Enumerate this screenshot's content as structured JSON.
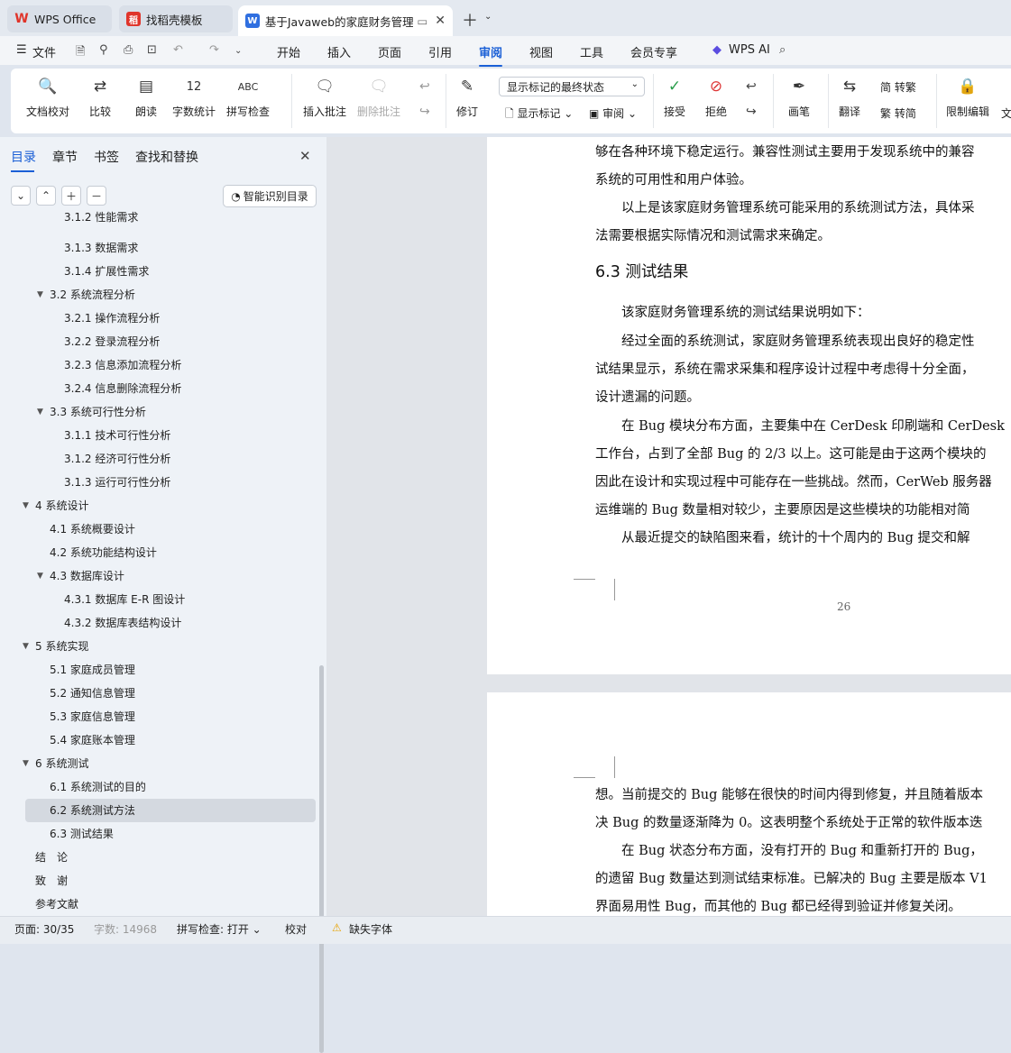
{
  "tabs": [
    {
      "label": "WPS Office",
      "icon": "wps-logo-icon"
    },
    {
      "label": "找稻壳模板",
      "icon": "docer-icon"
    },
    {
      "label": "基于Javaweb的家庭财务管理系",
      "icon": "word-doc-icon"
    }
  ],
  "menu": {
    "file": "文件",
    "items": [
      "开始",
      "插入",
      "页面",
      "引用",
      "审阅",
      "视图",
      "工具",
      "会员专享"
    ],
    "active": "审阅",
    "ai": "WPS AI"
  },
  "ribbon": {
    "doc_check": "文档校对",
    "compare": "比较",
    "read": "朗读",
    "word_count": "字数统计",
    "spell_check": "拼写检查",
    "insert_comment": "插入批注",
    "delete_comment": "删除批注",
    "revise": "修订",
    "display_select": "显示标记的最终状态",
    "show_marks": "显示标记",
    "review": "审阅",
    "accept": "接受",
    "reject": "拒绝",
    "pen": "画笔",
    "translate": "翻译",
    "to_trad": "转繁",
    "to_simp": "转简",
    "restrict": "限制编辑",
    "overflow": "文"
  },
  "sidebar": {
    "tabs": [
      "目录",
      "章节",
      "书签",
      "查找和替换"
    ],
    "smart_btn": "智能识别目录",
    "toc": [
      {
        "label": "3.1.2 性能需求",
        "lvl": 3
      },
      {
        "label": "3.1.3 数据需求",
        "lvl": 3
      },
      {
        "label": "3.1.4 扩展性需求",
        "lvl": 3
      },
      {
        "label": "3.2 系统流程分析",
        "lvl": 2,
        "exp": true
      },
      {
        "label": "3.2.1  操作流程分析",
        "lvl": 3
      },
      {
        "label": "3.2.2  登录流程分析",
        "lvl": 3
      },
      {
        "label": "3.2.3  信息添加流程分析",
        "lvl": 3
      },
      {
        "label": "3.2.4  信息删除流程分析",
        "lvl": 3
      },
      {
        "label": "3.3  系统可行性分析",
        "lvl": 2,
        "exp": true
      },
      {
        "label": "3.1.1  技术可行性分析",
        "lvl": 3
      },
      {
        "label": "3.1.2  经济可行性分析",
        "lvl": 3
      },
      {
        "label": "3.1.3  运行可行性分析",
        "lvl": 3
      },
      {
        "label": "4  系统设计",
        "lvl": 1,
        "exp": true
      },
      {
        "label": "4.1  系统概要设计",
        "lvl": 2
      },
      {
        "label": "4.2  系统功能结构设计",
        "lvl": 2
      },
      {
        "label": "4.3  数据库设计",
        "lvl": 2,
        "exp": true
      },
      {
        "label": "4.3.1  数据库 E-R 图设计",
        "lvl": 3
      },
      {
        "label": "4.3.2  数据库表结构设计",
        "lvl": 3
      },
      {
        "label": "5  系统实现",
        "lvl": 1,
        "exp": true
      },
      {
        "label": "5.1 家庭成员管理",
        "lvl": 2
      },
      {
        "label": "5.2  通知信息管理",
        "lvl": 2
      },
      {
        "label": "5.3 家庭信息管理",
        "lvl": 2
      },
      {
        "label": "5.4 家庭账本管理",
        "lvl": 2
      },
      {
        "label": "6  系统测试",
        "lvl": 1,
        "exp": true
      },
      {
        "label": "6.1 系统测试的目的",
        "lvl": 2
      },
      {
        "label": "6.2 系统测试方法",
        "lvl": 2,
        "hl": true
      },
      {
        "label": "6.3  测试结果",
        "lvl": 2
      },
      {
        "label": "结　论",
        "lvl": 1
      },
      {
        "label": "致　谢",
        "lvl": 1
      },
      {
        "label": "参考文献",
        "lvl": 1
      }
    ]
  },
  "doc": {
    "p1": [
      {
        "t": "够在各种环境下稳定运行。兼容性测试主要用于发现系统中的兼容"
      },
      {
        "t": "系统的可用性和用户体验。"
      },
      {
        "t": "　　以上是该家庭财务管理系统可能采用的系统测试方法，具体采"
      },
      {
        "t": "法需要根据实际情况和测试需求来确定。"
      },
      {
        "h": "6.3  测试结果"
      },
      {
        "t": "　　该家庭财务管理系统的测试结果说明如下："
      },
      {
        "t": "　　经过全面的系统测试，家庭财务管理系统表现出良好的稳定性"
      },
      {
        "t": "试结果显示，系统在需求采集和程序设计过程中考虑得十分全面，"
      },
      {
        "t": "设计遗漏的问题。"
      },
      {
        "t": "　　在 Bug 模块分布方面，主要集中在 CerDesk 印刷端和 CerDesk"
      },
      {
        "t": "工作台，占到了全部 Bug 的 2/3 以上。这可能是由于这两个模块的"
      },
      {
        "t": "因此在设计和实现过程中可能存在一些挑战。然而，CerWeb 服务器"
      },
      {
        "t": "运维端的 Bug 数量相对较少，主要原因是这些模块的功能相对简"
      },
      {
        "t": "　　从最近提交的缺陷图来看，统计的十个周内的 Bug 提交和解"
      }
    ],
    "page_num": "26",
    "p2": [
      "想。当前提交的 Bug 能够在很快的时间内得到修复，并且随着版本",
      "决 Bug 的数量逐渐降为 0。这表明整个系统处于正常的软件版本迭",
      "　　在 Bug 状态分布方面，没有打开的 Bug 和重新打开的 Bug，",
      "的遗留 Bug 数量达到测试结束标准。已解决的 Bug 主要是版本 V1",
      "界面易用性 Bug，而其他的 Bug 都已经得到验证并修复关闭。"
    ]
  },
  "status": {
    "page": "页面: 30/35",
    "words": "字数: 14968",
    "spell": "拼写检查: 打开",
    "proof": "校对",
    "missing_font": "缺失字体"
  }
}
